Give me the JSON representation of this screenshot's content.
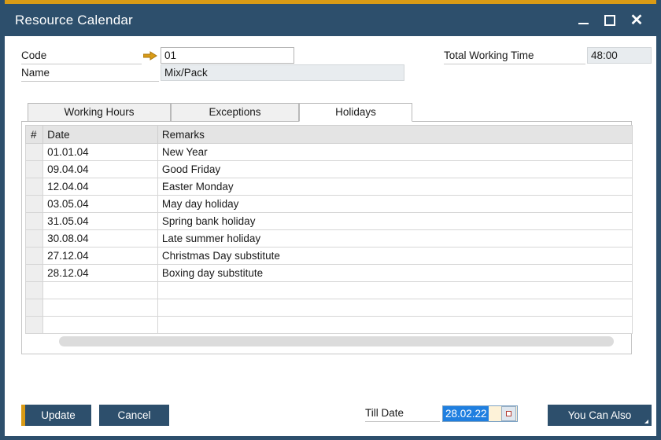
{
  "window": {
    "title": "Resource Calendar",
    "accent_color": "#d99b16",
    "titlebar_color": "#2d4f6c",
    "controls": {
      "minimize": "minimize",
      "maximize": "maximize",
      "close": "close"
    }
  },
  "form": {
    "code_label": "Code",
    "code_value": "01",
    "code_placeholder": "",
    "name_label": "Name",
    "name_value": "Mix/Pack",
    "name_placeholder": "",
    "total_working_time_label": "Total Working Time",
    "total_working_time_value": "48:00",
    "link_arrow_icon": "arrow-right-icon"
  },
  "tabs": [
    {
      "label": "Working Hours",
      "active": false
    },
    {
      "label": "Exceptions",
      "active": false
    },
    {
      "label": "Holidays",
      "active": true
    }
  ],
  "grid": {
    "columns": [
      "#",
      "Date",
      "Remarks"
    ],
    "rows": [
      {
        "num": "",
        "date": "01.01.04",
        "remarks": "New Year"
      },
      {
        "num": "",
        "date": "09.04.04",
        "remarks": "Good Friday"
      },
      {
        "num": "",
        "date": "12.04.04",
        "remarks": "Easter Monday"
      },
      {
        "num": "",
        "date": "03.05.04",
        "remarks": "May day holiday"
      },
      {
        "num": "",
        "date": "31.05.04",
        "remarks": "Spring bank holiday"
      },
      {
        "num": "",
        "date": "30.08.04",
        "remarks": "Late summer holiday"
      },
      {
        "num": "",
        "date": "27.12.04",
        "remarks": "Christmas Day substitute"
      },
      {
        "num": "",
        "date": "28.12.04",
        "remarks": "Boxing day substitute"
      },
      {
        "num": "",
        "date": "",
        "remarks": ""
      },
      {
        "num": "",
        "date": "",
        "remarks": ""
      },
      {
        "num": "",
        "date": "",
        "remarks": ""
      }
    ]
  },
  "footer": {
    "update_label": "Update",
    "cancel_label": "Cancel",
    "till_date_label": "Till Date",
    "till_date_value": "28.02.22",
    "calendar_icon": "calendar-icon",
    "you_can_also_label": "You Can Also"
  }
}
